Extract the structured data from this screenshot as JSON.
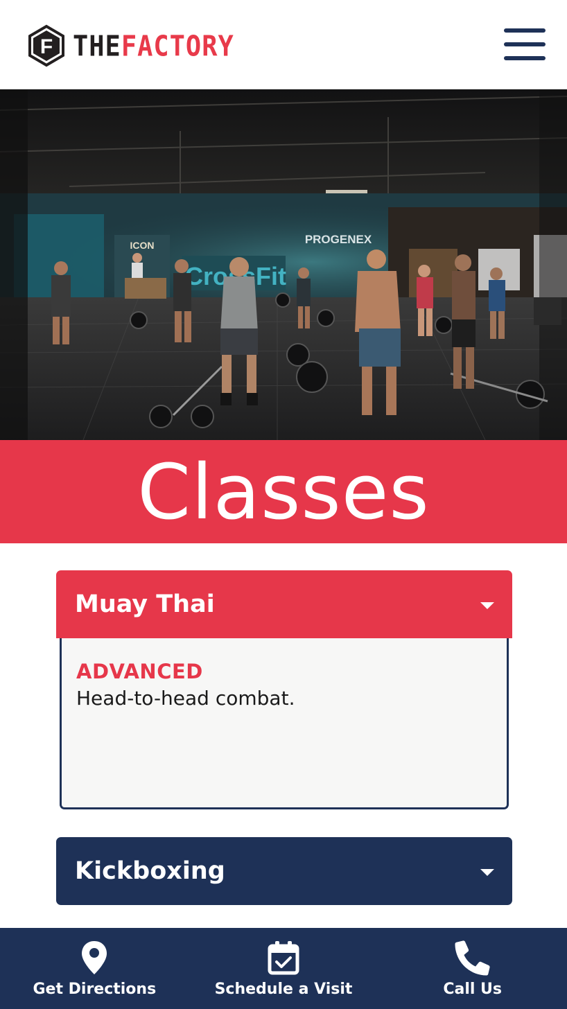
{
  "header": {
    "logo_word_the": "THE",
    "logo_word_factory": "FACTORY",
    "logo_letter": "F",
    "menu_icon": "hamburger-menu-icon",
    "brand_colors": {
      "dark": "#231f20",
      "red": "#e83a4a",
      "navy": "#1e3157"
    }
  },
  "hero": {
    "image_description": "dark gym interior with people lifting barbells",
    "wall_signs": [
      "ICON",
      "CrossFit",
      "PROGENEX"
    ]
  },
  "title_banner": {
    "title": "Classes",
    "background_color": "#e6374a"
  },
  "accordion": {
    "items": [
      {
        "title": "Muay Thai",
        "expanded": true,
        "level": "ADVANCED",
        "description": "Head-to-head combat.",
        "caret_icon": "caret-down-icon",
        "header_color": "#e6374a"
      },
      {
        "title": "Kickboxing",
        "expanded": false,
        "caret_icon": "caret-down-icon",
        "header_color": "#1e3157"
      }
    ]
  },
  "bottom_bar": {
    "background_color": "#1e3157",
    "items": [
      {
        "label": "Get Directions",
        "icon": "map-pin-icon"
      },
      {
        "label": "Schedule a Visit",
        "icon": "calendar-check-icon"
      },
      {
        "label": "Call Us",
        "icon": "phone-icon"
      }
    ]
  }
}
